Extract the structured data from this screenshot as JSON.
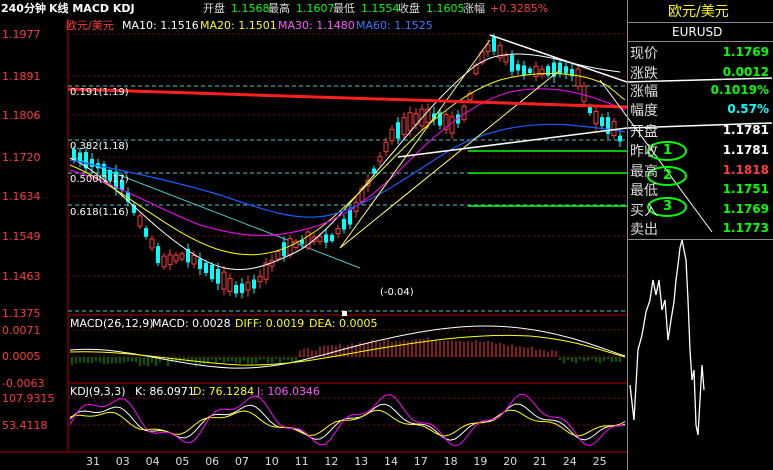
{
  "header": {
    "period": "240分钟",
    "chart_name": "K线 MACD KDJ",
    "open_label": "开盘",
    "open_value": "1.1568",
    "high_label": "最高",
    "high_value": "1.1607",
    "low_label": "最低",
    "low_value": "1.1554",
    "close_label": "收盘",
    "close_value": "1.1605",
    "change_label": "涨幅",
    "change_value": "+0.3285%"
  },
  "main_chart": {
    "symbol_label": "欧元/美元",
    "ma10": "MA10: 1.1516",
    "ma20": "MA20: 1.1501",
    "ma30": "MA30: 1.1480",
    "ma60": "MA60: 1.1525",
    "y_ticks": [
      "1.1977",
      "1.1891",
      "1.1806",
      "1.1720",
      "1.1634",
      "1.1549",
      "1.1463",
      "1.1375"
    ],
    "fib_labels": [
      "0.191(1.19)",
      "0.382(1.18)",
      "0.500(1.17)",
      "0.618(1.16)"
    ],
    "annotation": "(-0.04)",
    "circle_labels": [
      "1",
      "2",
      "3"
    ]
  },
  "macd": {
    "title": "MACD(26,12,9)",
    "macd_value": "MACD: 0.0028",
    "diff_value": "DIFF: 0.0019",
    "dea_value": "DEA: 0.0005",
    "y_ticks": [
      "0.0071",
      "0.0005",
      "-0.0063"
    ]
  },
  "kdj": {
    "title": "KDJ(9,3,3)",
    "k_value": "K: 86.0971",
    "d_value": "D: 76.1284",
    "j_value": "J: 106.0346",
    "y_ticks": [
      "107.9315",
      "53.4118"
    ]
  },
  "x_axis": [
    "31",
    "03",
    "04",
    "05",
    "06",
    "07",
    "10",
    "11",
    "12",
    "13",
    "14",
    "17",
    "18",
    "19",
    "20",
    "21",
    "24",
    "25"
  ],
  "quote_panel": {
    "title": "欧元/美元",
    "code": "EURUSD",
    "rows": [
      {
        "label": "现价",
        "value": "1.1769",
        "color": "#00ff00"
      },
      {
        "label": "涨跌",
        "value": "0.0012",
        "color": "#00ff00"
      },
      {
        "label": "涨幅",
        "value": "0.1019%",
        "color": "#00ff00"
      },
      {
        "label": "幅度",
        "value": "0.57%",
        "color": "#00ffff"
      },
      {
        "label": "开盘",
        "value": "1.1781",
        "color": "#ffffff"
      },
      {
        "label": "昨收",
        "value": "1.1781",
        "color": "#ffffff"
      },
      {
        "label": "最高",
        "value": "1.1818",
        "color": "#ff3b3b"
      },
      {
        "label": "最低",
        "value": "1.1751",
        "color": "#00ff00"
      },
      {
        "label": "买入",
        "value": "1.1769",
        "color": "#00ff00"
      },
      {
        "label": "卖出",
        "value": "1.1773",
        "color": "#00ff00"
      }
    ]
  },
  "colors": {
    "up": "#ff3b3b",
    "down": "#00ffff",
    "ma10": "#ffffff",
    "ma20": "#ffff00",
    "ma30": "#ff00ff",
    "ma60": "#0066ff",
    "accent_green": "#00ff00"
  }
}
